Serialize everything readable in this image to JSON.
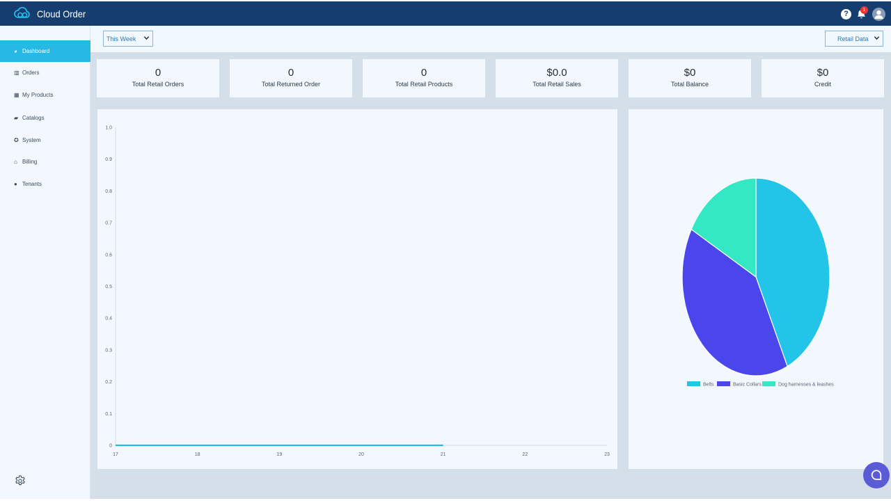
{
  "app": {
    "title": "Cloud Order",
    "notification_count": "1",
    "help_glyph": "?"
  },
  "icons": {
    "brand": "cloud-icon",
    "help": "help-icon",
    "notifications": "bell-icon",
    "user": "user-avatar-icon",
    "settings": "gear-icon",
    "chat": "chat-icon"
  },
  "colors": {
    "header": "#153d6f",
    "accent": "#27b9e6",
    "sidebar": "#f2f8fe",
    "content_bg": "#d4dfea"
  },
  "sidebar": {
    "items": [
      {
        "label": "Dashboard",
        "icon": "pie-chart-icon",
        "glyph": "◕",
        "active": true
      },
      {
        "label": "Orders",
        "icon": "bar-chart-icon",
        "glyph": "▥",
        "active": false
      },
      {
        "label": "My Products",
        "icon": "boxes-icon",
        "glyph": "▦",
        "active": false
      },
      {
        "label": "Catalogs",
        "icon": "folder-open-icon",
        "glyph": "▰",
        "active": false
      },
      {
        "label": "System",
        "icon": "users-cog-icon",
        "glyph": "✪",
        "active": false
      },
      {
        "label": "Billing",
        "icon": "bank-icon",
        "glyph": "⌂",
        "active": false
      },
      {
        "label": "Tenants",
        "icon": "user-tenant-icon",
        "glyph": "●",
        "active": false
      }
    ]
  },
  "filters": {
    "period": "This Week",
    "dataset": "Retail Data"
  },
  "stats": [
    {
      "value": "0",
      "label": "Total Retail Orders"
    },
    {
      "value": "0",
      "label": "Total Returned Order"
    },
    {
      "value": "0",
      "label": "Total Retail Products"
    },
    {
      "value": "$0.0",
      "label": "Total Retail Sales"
    },
    {
      "value": "$0",
      "label": "Total Balance"
    },
    {
      "value": "$0",
      "label": "Credit"
    }
  ],
  "chart_data": [
    {
      "type": "line",
      "x": [
        17,
        18,
        19,
        20,
        21
      ],
      "xticks": [
        "17",
        "18",
        "19",
        "20",
        "21",
        "22",
        "23"
      ],
      "xlim": [
        17,
        23
      ],
      "yticks": [
        "0",
        "0.1",
        "0.2",
        "0.3",
        "0.4",
        "0.5",
        "0.6",
        "0.7",
        "0.8",
        "0.9",
        "1.0"
      ],
      "ylim": [
        0,
        1
      ],
      "series": [
        {
          "values": [
            0,
            0,
            0,
            0,
            0
          ],
          "color": "#27b9e6"
        }
      ],
      "grid": false
    },
    {
      "type": "pie",
      "slices": [
        {
          "label": "Belts",
          "value": 43,
          "color": "#22c4e8"
        },
        {
          "label": "Basic Collars",
          "value": 40,
          "color": "#4a46ec"
        },
        {
          "label": "Dog harnesses & leashes",
          "value": 17,
          "color": "#33e8c3"
        }
      ],
      "legend": "bottom"
    }
  ]
}
